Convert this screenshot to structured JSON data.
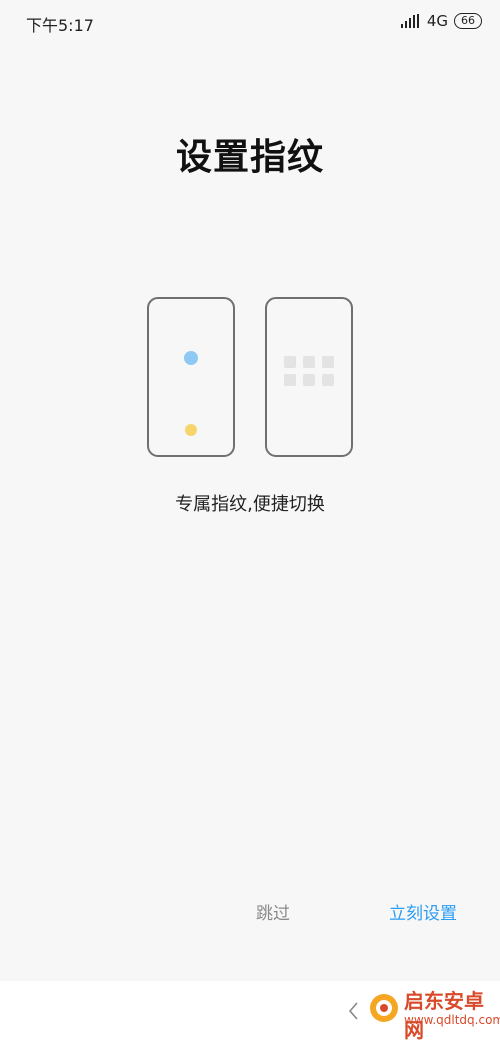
{
  "status_bar": {
    "time": "下午5:17",
    "network": "4G",
    "battery": "66"
  },
  "page": {
    "title": "设置指纹",
    "subtitle": "专属指纹,便捷切换"
  },
  "actions": {
    "skip_label": "跳过",
    "setup_label": "立刻设置"
  },
  "watermark": {
    "name": "启东安卓网",
    "url": "www.qdltdq.com"
  },
  "colors": {
    "accent": "#2a9df4",
    "background": "#f7f7f7",
    "fingerprint_dot": "#8ec9f5",
    "yellow_dot": "#f6d56c",
    "phone_outline": "#707070",
    "watermark": "#d84a2a"
  }
}
